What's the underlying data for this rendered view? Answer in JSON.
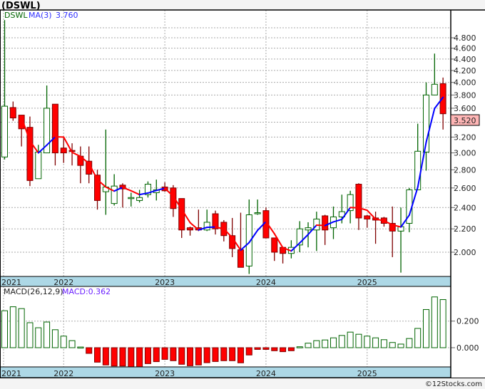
{
  "title": "(DSWL)",
  "copyright": "©12Stocks.com",
  "price_legend": {
    "symbol": "DSWL",
    "ma_label": "MA(3)",
    "ma_value": "3.760"
  },
  "macd_legend": {
    "label": "MACD(26,12,9)",
    "value": "MACD:0.362"
  },
  "last_price": "3.520",
  "colors": {
    "up": "#006400",
    "down": "#ff0000",
    "down_edge": "#800000",
    "ma_up": "#0000ff",
    "ma_down": "#ff0000",
    "axis_strip": "#add8e6",
    "last_price_box": "#ffb6b6"
  },
  "chart_data": [
    {
      "type": "candlestick",
      "title": "",
      "scale": "log",
      "grid": true,
      "ylim": [
        1.8,
        5.2
      ],
      "y_ticks": [
        "4.800",
        "4.600",
        "4.400",
        "4.200",
        "4.000",
        "3.800",
        "3.600",
        "3.400",
        "3.200",
        "3.000",
        "2.800",
        "2.600",
        "2.400",
        "2.200",
        "2.000"
      ],
      "x_ticks": [
        "2021",
        "2022",
        "2023",
        "2024",
        "2025"
      ],
      "x_tick_months": [
        "2021-06",
        "2022-01",
        "2023-01",
        "2024-01",
        "2025-01"
      ],
      "moving_average": {
        "name": "MA(3)",
        "period": 3
      },
      "months": [
        "2021-06",
        "2021-07",
        "2021-08",
        "2021-09",
        "2021-10",
        "2021-11",
        "2021-12",
        "2022-01",
        "2022-02",
        "2022-03",
        "2022-04",
        "2022-05",
        "2022-06",
        "2022-07",
        "2022-08",
        "2022-09",
        "2022-10",
        "2022-11",
        "2022-12",
        "2023-01",
        "2023-02",
        "2023-03",
        "2023-04",
        "2023-05",
        "2023-06",
        "2023-07",
        "2023-08",
        "2023-09",
        "2023-10",
        "2023-11",
        "2023-12",
        "2024-01",
        "2024-02",
        "2024-03",
        "2024-04",
        "2024-05",
        "2024-06",
        "2024-07",
        "2024-08",
        "2024-09",
        "2024-10",
        "2024-11",
        "2024-12",
        "2025-01",
        "2025-02",
        "2025-03",
        "2025-04",
        "2025-05",
        "2025-06",
        "2025-07",
        "2025-08",
        "2025-09",
        "2025-10"
      ],
      "ohlc": [
        [
          2.95,
          5.16,
          2.92,
          3.63
        ],
        [
          3.61,
          3.7,
          3.42,
          3.46
        ],
        [
          3.5,
          3.5,
          3.08,
          3.31
        ],
        [
          3.33,
          3.48,
          2.62,
          2.68
        ],
        [
          2.7,
          3.1,
          2.7,
          3.01
        ],
        [
          3.0,
          3.95,
          3.0,
          3.6
        ],
        [
          3.66,
          3.66,
          2.85,
          3.0
        ],
        [
          3.06,
          3.2,
          2.88,
          3.0
        ],
        [
          3.03,
          3.12,
          2.85,
          3.02
        ],
        [
          2.96,
          3.08,
          2.65,
          2.85
        ],
        [
          2.9,
          3.08,
          2.65,
          2.75
        ],
        [
          2.74,
          2.8,
          2.38,
          2.47
        ],
        [
          2.56,
          3.3,
          2.33,
          2.61
        ],
        [
          2.44,
          2.75,
          2.42,
          2.62
        ],
        [
          2.63,
          2.65,
          2.4,
          2.59
        ],
        [
          2.49,
          2.55,
          2.41,
          2.5
        ],
        [
          2.47,
          2.58,
          2.45,
          2.5
        ],
        [
          2.53,
          2.67,
          2.5,
          2.64
        ],
        [
          2.55,
          2.69,
          2.47,
          2.58
        ],
        [
          2.61,
          2.66,
          2.56,
          2.57
        ],
        [
          2.6,
          2.63,
          2.31,
          2.39
        ],
        [
          2.49,
          2.49,
          2.12,
          2.19
        ],
        [
          2.21,
          2.22,
          2.14,
          2.19
        ],
        [
          2.21,
          2.38,
          2.18,
          2.19
        ],
        [
          2.19,
          2.38,
          2.18,
          2.26
        ],
        [
          2.34,
          2.37,
          2.15,
          2.2
        ],
        [
          2.26,
          2.28,
          2.09,
          2.14
        ],
        [
          2.14,
          2.3,
          1.96,
          2.03
        ],
        [
          2.02,
          2.35,
          1.88,
          1.88
        ],
        [
          1.89,
          2.48,
          1.83,
          2.33
        ],
        [
          2.34,
          2.48,
          2.33,
          2.35
        ],
        [
          2.37,
          2.4,
          2.12,
          2.12
        ],
        [
          2.12,
          2.12,
          1.93,
          2.0
        ],
        [
          2.04,
          2.04,
          1.91,
          1.99
        ],
        [
          1.99,
          2.1,
          1.95,
          2.04
        ],
        [
          2.06,
          2.27,
          2.0,
          2.2
        ],
        [
          2.19,
          2.26,
          2.04,
          2.21
        ],
        [
          2.19,
          2.36,
          2.01,
          2.29
        ],
        [
          2.32,
          2.33,
          2.06,
          2.19
        ],
        [
          2.21,
          2.41,
          2.11,
          2.31
        ],
        [
          2.31,
          2.53,
          2.25,
          2.36
        ],
        [
          2.37,
          2.57,
          2.25,
          2.53
        ],
        [
          2.64,
          2.65,
          2.19,
          2.3
        ],
        [
          2.32,
          2.33,
          2.21,
          2.29
        ],
        [
          2.3,
          2.36,
          2.07,
          2.28
        ],
        [
          2.3,
          2.31,
          2.22,
          2.25
        ],
        [
          2.25,
          2.41,
          1.96,
          2.18
        ],
        [
          2.18,
          2.4,
          1.84,
          2.22
        ],
        [
          2.25,
          2.6,
          2.17,
          2.58
        ],
        [
          2.58,
          3.38,
          2.58,
          3.02
        ],
        [
          3.01,
          4.0,
          2.79,
          3.8
        ],
        [
          3.8,
          4.5,
          3.8,
          3.97
        ],
        [
          3.98,
          4.08,
          3.3,
          3.52
        ]
      ]
    },
    {
      "type": "bar",
      "title": "MACD(26,12,9)",
      "grid": true,
      "ylim": [
        -0.15,
        0.42
      ],
      "y_ticks": [
        "0.200",
        "0.000"
      ],
      "x_ticks": [
        "2021",
        "2022",
        "2023",
        "2024",
        "2025"
      ],
      "values": [
        0.278,
        0.308,
        0.294,
        0.188,
        0.15,
        0.193,
        0.135,
        0.087,
        0.053,
        0.005,
        -0.043,
        -0.109,
        -0.13,
        -0.138,
        -0.138,
        -0.145,
        -0.145,
        -0.12,
        -0.105,
        -0.088,
        -0.098,
        -0.125,
        -0.136,
        -0.13,
        -0.113,
        -0.104,
        -0.098,
        -0.098,
        -0.114,
        -0.055,
        -0.013,
        -0.013,
        -0.023,
        -0.03,
        -0.023,
        0.007,
        0.034,
        0.053,
        0.058,
        0.074,
        0.092,
        0.117,
        0.101,
        0.087,
        0.074,
        0.06,
        0.039,
        0.027,
        0.069,
        0.145,
        0.287,
        0.382,
        0.362
      ]
    }
  ]
}
